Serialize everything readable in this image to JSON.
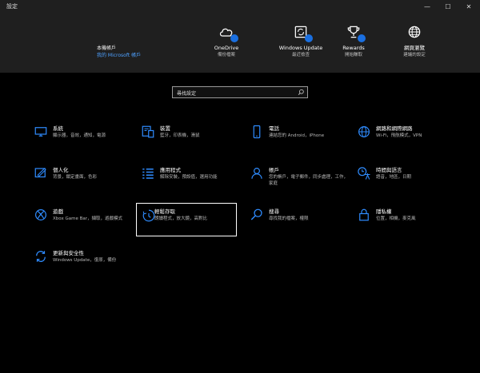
{
  "window": {
    "title": "設定",
    "min_glyph": "—",
    "max_glyph": "☐",
    "close_glyph": "✕"
  },
  "account": {
    "line1": "本機帳戶",
    "line2": "我的 Microsoft 帳戶"
  },
  "shortcuts": [
    {
      "title": "OneDrive",
      "subtitle": "備份檔案",
      "icon": "cloud-icon"
    },
    {
      "title": "Windows Update",
      "subtitle": "最近檢查",
      "icon": "update-icon"
    },
    {
      "title": "Rewards",
      "subtitle": "開始賺取",
      "icon": "trophy-icon"
    },
    {
      "title": "網頁瀏覽",
      "subtitle": "建議的設定",
      "icon": "globe-icon"
    }
  ],
  "search": {
    "placeholder": "尋找設定"
  },
  "tiles": [
    {
      "name": "系統",
      "desc": "顯示器，音效，通知，電源",
      "icon": "monitor-icon"
    },
    {
      "name": "裝置",
      "desc": "藍牙，印表機，滑鼠",
      "icon": "devices-icon"
    },
    {
      "name": "電話",
      "desc": "連結您的 Android，iPhone",
      "icon": "phone-icon"
    },
    {
      "name": "網路和網際網路",
      "desc": "Wi-Fi，飛航模式，VPN",
      "icon": "network-icon"
    },
    {
      "name": "個人化",
      "desc": "背景，鎖定畫面，色彩",
      "icon": "brush-icon"
    },
    {
      "name": "應用程式",
      "desc": "解除安裝，預設值，選用功能",
      "icon": "apps-icon"
    },
    {
      "name": "帳戶",
      "desc": "您的帳戶，電子郵件，同步處理，工作，家庭",
      "icon": "person-icon"
    },
    {
      "name": "時間與語言",
      "desc": "語音，地區，日期",
      "icon": "time-language-icon"
    },
    {
      "name": "遊戲",
      "desc": "Xbox Game Bar，擷取，遊戲模式",
      "icon": "xbox-icon"
    },
    {
      "name": "輕鬆存取",
      "desc": "朗讀程式，放大鏡，高對比",
      "icon": "ease-of-access-icon"
    },
    {
      "name": "搜尋",
      "desc": "尋找我的檔案，權限",
      "icon": "search-icon"
    },
    {
      "name": "隱私權",
      "desc": "位置，相機，麥克風",
      "icon": "lock-icon"
    },
    {
      "name": "更新與安全性",
      "desc": "Windows Update，復原，備份",
      "icon": "sync-icon"
    }
  ],
  "colors": {
    "accent": "#2f8cff",
    "badge": "#1a6fe0",
    "header_bg": "#1f1f1f",
    "bg": "#000000"
  }
}
